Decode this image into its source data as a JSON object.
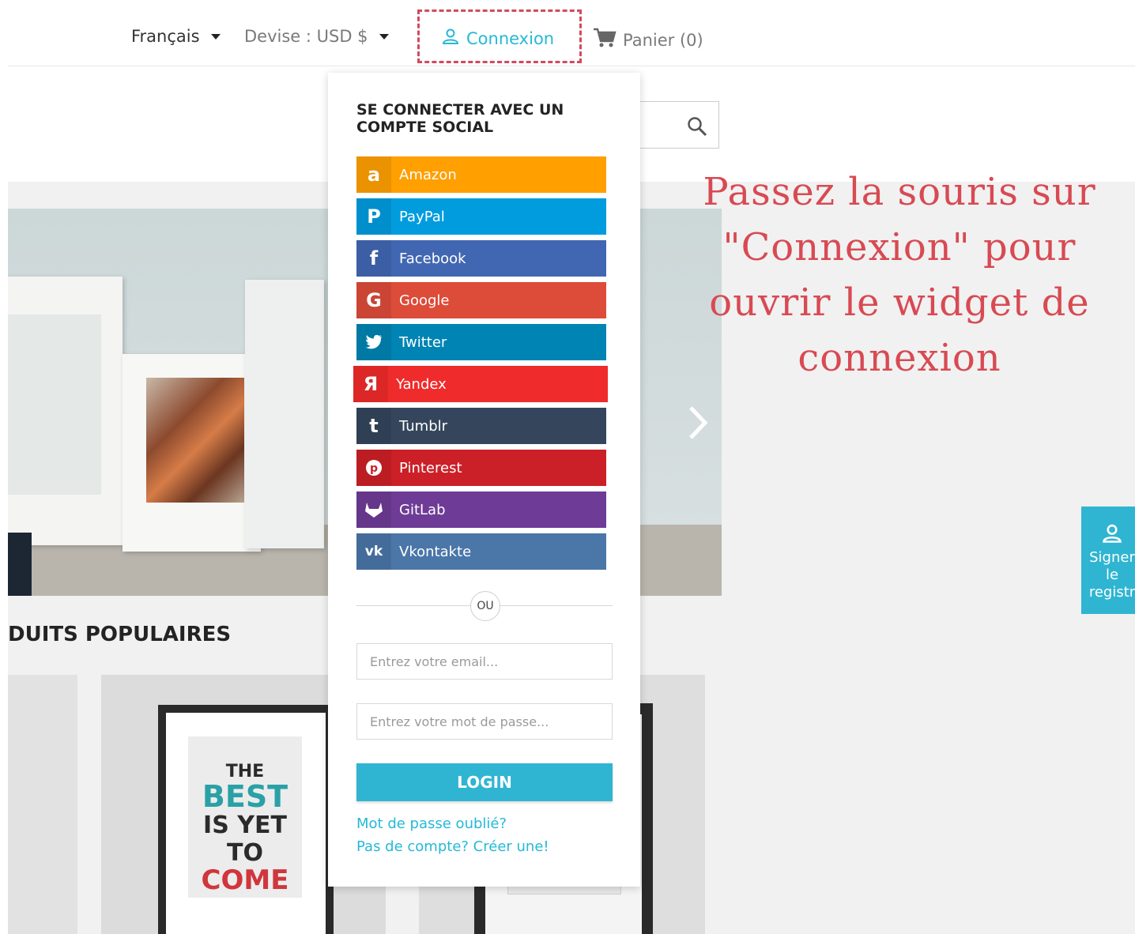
{
  "topbar": {
    "language": "Français",
    "currency": "Devise : USD $",
    "login": "Connexion",
    "cart": "Panier (0)"
  },
  "section": {
    "title": "DUITS POPULAIRES"
  },
  "poster": {
    "line1": "THE",
    "line2": "BEST",
    "line3": "IS YET TO",
    "line4": "COME"
  },
  "overlay": {
    "text": "Passez la souris sur \"Connexion\" pour ouvrir le widget de connexion"
  },
  "side_tab": {
    "line1": "Signer",
    "line2": "le",
    "line3": "registr"
  },
  "widget": {
    "title": "SE CONNECTER AVEC UN COMPTE SOCIAL",
    "socials": [
      {
        "label": "Amazon",
        "icon": "amazon-icon",
        "color": "#ff9f00"
      },
      {
        "label": "PayPal",
        "icon": "paypal-icon",
        "color": "#009cde"
      },
      {
        "label": "Facebook",
        "icon": "facebook-icon",
        "color": "#4267b2"
      },
      {
        "label": "Google",
        "icon": "google-icon",
        "color": "#dd4b39"
      },
      {
        "label": "Twitter",
        "icon": "twitter-icon",
        "color": "#0084b4"
      },
      {
        "label": "Yandex",
        "icon": "yandex-icon",
        "color": "#f02b2b"
      },
      {
        "label": "Tumblr",
        "icon": "tumblr-icon",
        "color": "#35465c"
      },
      {
        "label": "Pinterest",
        "icon": "pinterest-icon",
        "color": "#cb2027"
      },
      {
        "label": "GitLab",
        "icon": "gitlab-icon",
        "color": "#6e3b96"
      },
      {
        "label": "Vkontakte",
        "icon": "vkontakte-icon",
        "color": "#4a76a8"
      }
    ],
    "or": "OU",
    "email_placeholder": "Entrez votre email...",
    "password_placeholder": "Entrez votre mot de passe...",
    "login_button": "LOGIN",
    "forgot_link": "Mot de passe oublié?",
    "create_link": "Pas de compte? Créer une!"
  },
  "colors": {
    "accent": "#25b9d7",
    "highlight": "#d14a60",
    "overlay_text": "#d84a53"
  }
}
